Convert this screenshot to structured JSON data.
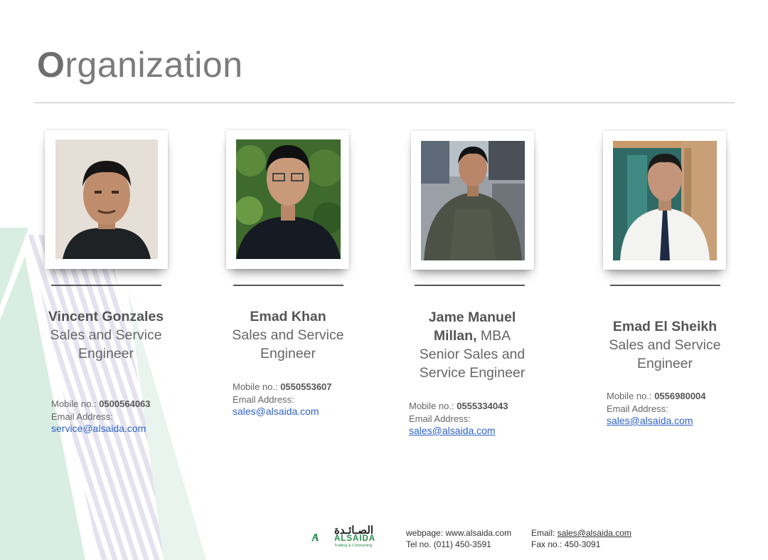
{
  "page": {
    "title_first": "O",
    "title_rest": "rganization"
  },
  "people": [
    {
      "name": "Vincent Gonzales",
      "name_suffix": "",
      "role": "Sales and Service Engineer",
      "mobile_label": "Mobile no.: ",
      "mobile": "0500564063",
      "email_label": "Email Address:",
      "email": "service@alsaida.com"
    },
    {
      "name": "Emad Khan",
      "name_suffix": "",
      "role": "Sales and Service Engineer",
      "mobile_label": "Mobile no.: ",
      "mobile": "0550553607",
      "email_label": "Email Address:",
      "email": "sales@alsaida.com"
    },
    {
      "name": "Jame Manuel Millan,",
      "name_suffix": " MBA",
      "role": "Senior Sales and Service Engineer",
      "mobile_label": "Mobile no.: ",
      "mobile": "0555334043",
      "email_label": "Email Address:",
      "email": "sales@alsaida.com"
    },
    {
      "name": "Emad El Sheikh",
      "name_suffix": "",
      "role": "Sales and Service Engineer",
      "mobile_label": "Mobile no.: ",
      "mobile": "0556980004",
      "email_label": "Email Address:",
      "email": "sales@alsaida.com"
    }
  ],
  "footer": {
    "logo_arabic": "الصـائـدة",
    "logo_name": "ALSAIDA",
    "logo_sub": "Trading & Contracting",
    "webpage": "webpage: www.alsaida.com",
    "tel": "Tel no. (011) 450-3591",
    "email_label": "Email: ",
    "email": "sales@alsaida.com",
    "fax": "Fax no.: 450-3091"
  },
  "colors": {
    "accent_green": "#2a8a4a",
    "watermark_green": "#d6ece0",
    "link_blue": "#2f62c8"
  }
}
